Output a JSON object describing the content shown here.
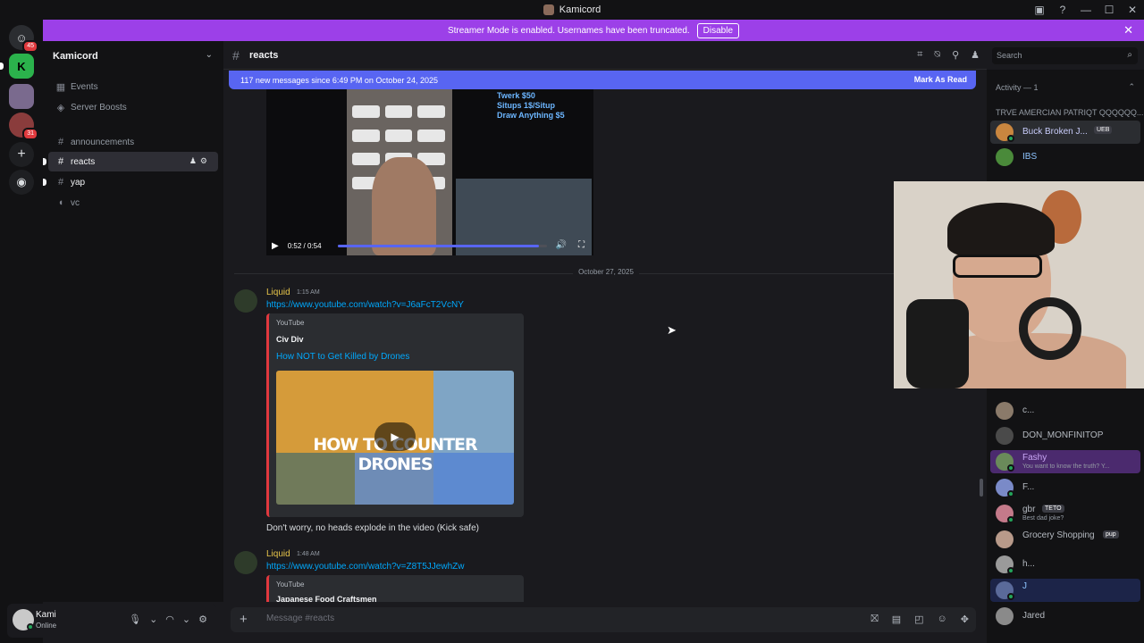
{
  "window": {
    "title": "Kamicord"
  },
  "banner": {
    "text": "Streamer Mode is enabled. Usernames have been truncated.",
    "button": "Disable"
  },
  "rail": {
    "badges": [
      "45",
      "31"
    ]
  },
  "server": {
    "name": "Kamicord"
  },
  "sidebar": {
    "items": [
      {
        "label": "Events",
        "icon": "calendar-icon"
      },
      {
        "label": "Server Boosts",
        "icon": "boost-icon"
      },
      {
        "label": "announcements",
        "icon": "hash-icon"
      },
      {
        "label": "reacts",
        "icon": "hash-icon",
        "active": true
      },
      {
        "label": "yap",
        "icon": "hash-icon"
      },
      {
        "label": "vc",
        "icon": "speaker-icon"
      }
    ]
  },
  "user": {
    "name": "Kami",
    "status": "Online"
  },
  "header": {
    "channel": "reacts"
  },
  "search": {
    "placeholder": "Search"
  },
  "new_messages": {
    "text": "117 new messages since 6:49 PM on October 24, 2025",
    "action": "Mark As Read"
  },
  "video": {
    "time": "0:52 / 0:54",
    "progress": 0.96,
    "overlay_text": [
      "Twerk $50",
      "Situps 1$/Situp",
      "Draw Anything $5"
    ]
  },
  "date_divider": "October 27, 2025",
  "messages": [
    {
      "author": "Liquid",
      "time": "1:15 AM",
      "link": "https://www.youtube.com/watch?v=J6aFcT2VcNY",
      "embed": {
        "provider": "YouTube",
        "author": "Civ Div",
        "title": "How NOT to Get Killed by Drones",
        "thumbnail_text": "HOW TO COUNTER DRONES"
      },
      "text": "Don't worry, no heads explode in the video (Kick safe)"
    },
    {
      "author": "Liquid",
      "time": "1:48 AM",
      "link": "https://www.youtube.com/watch?v=Z8T5JJewhZw",
      "embed": {
        "provider": "YouTube",
        "author": "Japanese Food Craftsmen"
      }
    }
  ],
  "composer": {
    "placeholder": "Message #reacts"
  },
  "members": {
    "activity_header": "Activity — 1",
    "group": "TRVE AMERCIAN PATRIQT QQQQQQ...",
    "list": [
      {
        "name": "Buck Broken J...",
        "tag": "UEB",
        "color": "#c9cdfb"
      },
      {
        "name": "IBS",
        "color": "#8ec5ff"
      },
      {
        "name": "c..."
      },
      {
        "name": "DON_MONFINITOP"
      },
      {
        "name": "Fashy",
        "sub": "You want to know the truth? Y..."
      },
      {
        "name": "F..."
      },
      {
        "name": "gbr",
        "tag": "TETO",
        "sub": "Best dad joke?"
      },
      {
        "name": "Grocery Shopping",
        "tag": "pup"
      },
      {
        "name": "h..."
      },
      {
        "name": "J"
      },
      {
        "name": "Jared"
      }
    ]
  }
}
